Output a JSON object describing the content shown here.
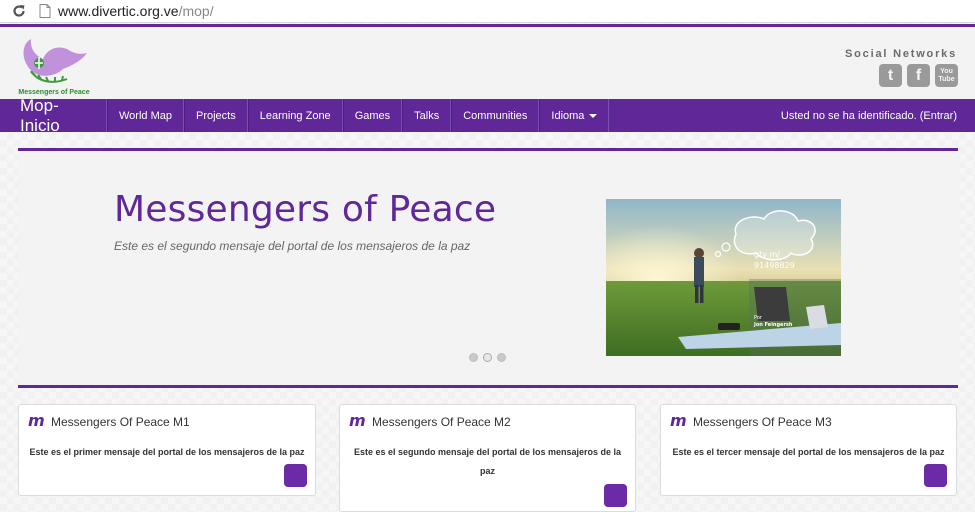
{
  "browser": {
    "url_host": "www.divertic.org.ve",
    "url_path": "/mop/"
  },
  "header": {
    "logo_text": "Messengers of Peace",
    "social_title": "Social Networks",
    "social": [
      {
        "icon": "twitter-icon",
        "glyph": "t"
      },
      {
        "icon": "facebook-icon",
        "glyph": "f"
      },
      {
        "icon": "youtube-icon",
        "glyph": "You Tube"
      }
    ]
  },
  "nav": {
    "brand": "Mop-Inicio",
    "items": [
      "World Map",
      "Projects",
      "Learning Zone",
      "Games",
      "Talks",
      "Communities"
    ],
    "language": "Idioma",
    "login": "Usted no se ha identificado. (Entrar)"
  },
  "hero": {
    "title": "Messengers of Peace",
    "subtitle": "Este es el segundo mensaje del portal de los mensajeros de la paz",
    "image_caption_1": "gty m/",
    "image_caption_2": "91498829",
    "image_credit_1": "Por",
    "image_credit_2": "Jon Feingersh",
    "slides": 3,
    "active_slide": 2
  },
  "cards": [
    {
      "title": "Messengers Of Peace M1",
      "text": "Este es el primer mensaje del portal de los mensajeros de la paz"
    },
    {
      "title": "Messengers Of Peace M2",
      "text": "Este es el segundo mensaje del portal de los mensajeros de la paz"
    },
    {
      "title": "Messengers Of Peace M3",
      "text": "Este es el tercer mensaje del portal de los mensajeros de la paz"
    }
  ],
  "colors": {
    "brand_purple": "#5f2798",
    "button_purple": "#6b2aa6"
  }
}
